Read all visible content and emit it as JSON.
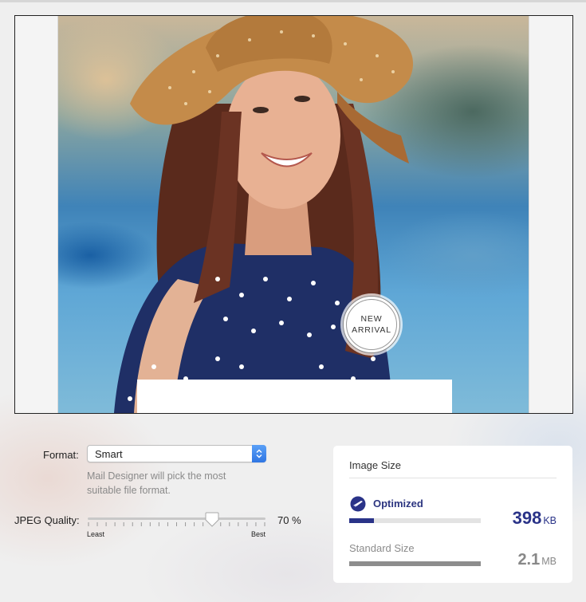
{
  "preview": {
    "badge_line1": "NEW",
    "badge_line2": "ARRIVAL"
  },
  "format": {
    "label": "Format:",
    "selected": "Smart",
    "help": "Mail Designer will pick the most suitable file format."
  },
  "jpeg_quality": {
    "label": "JPEG Quality:",
    "value": 70,
    "value_text": "70 %",
    "min_label": "Least",
    "max_label": "Best"
  },
  "image_size": {
    "title": "Image Size",
    "optimized": {
      "label": "Optimized",
      "value": "398",
      "unit": "KB",
      "fraction": 0.19,
      "icon": "rocket-icon",
      "color": "#2a3388"
    },
    "standard": {
      "label": "Standard Size",
      "value": "2.1",
      "unit": "MB",
      "fraction": 1.0,
      "color": "#8d8d8d"
    }
  }
}
